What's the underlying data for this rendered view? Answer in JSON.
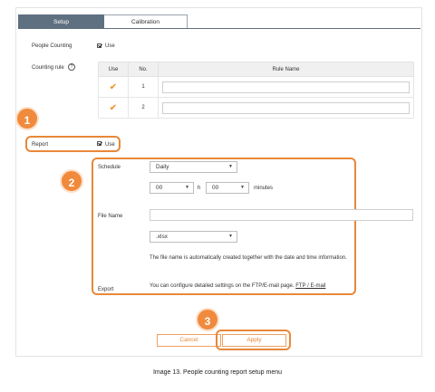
{
  "tabs": [
    {
      "label": "Setup",
      "active": true
    },
    {
      "label": "Calibration",
      "active": false
    }
  ],
  "people_counting": {
    "label": "People Counting",
    "use_label": "Use",
    "checked": true
  },
  "counting_rule": {
    "label": "Counting rule",
    "info_icon": "question-icon",
    "columns": [
      "Use",
      "No.",
      "Rule Name"
    ],
    "rows": [
      {
        "use": "check-icon",
        "no": "1",
        "rule_name": ""
      },
      {
        "use": "check-icon",
        "no": "2",
        "rule_name": ""
      }
    ]
  },
  "report": {
    "label": "Report",
    "use_label": "Use",
    "checked": true
  },
  "schedule": {
    "label": "Schedule",
    "period": "Daily",
    "hour": "00",
    "hour_unit": "h",
    "minute": "00",
    "minute_unit": "minutes"
  },
  "file_name": {
    "label": "File Name",
    "value": "",
    "extension": ".xlsx",
    "note": "The file name is automatically created together with the date and time information."
  },
  "export": {
    "label": "Export",
    "note": "You can configure detailed settings on the FTP/E-mail page.",
    "link": "FTP / E-mail"
  },
  "buttons": {
    "cancel": "Cancel",
    "apply": "Apply"
  },
  "callouts": [
    "1",
    "2",
    "3"
  ],
  "caption": "Image 13. People counting report setup menu",
  "colors": {
    "accent": "#f08a3c",
    "tab_active": "#5f7080",
    "check": "#f08c1e"
  }
}
